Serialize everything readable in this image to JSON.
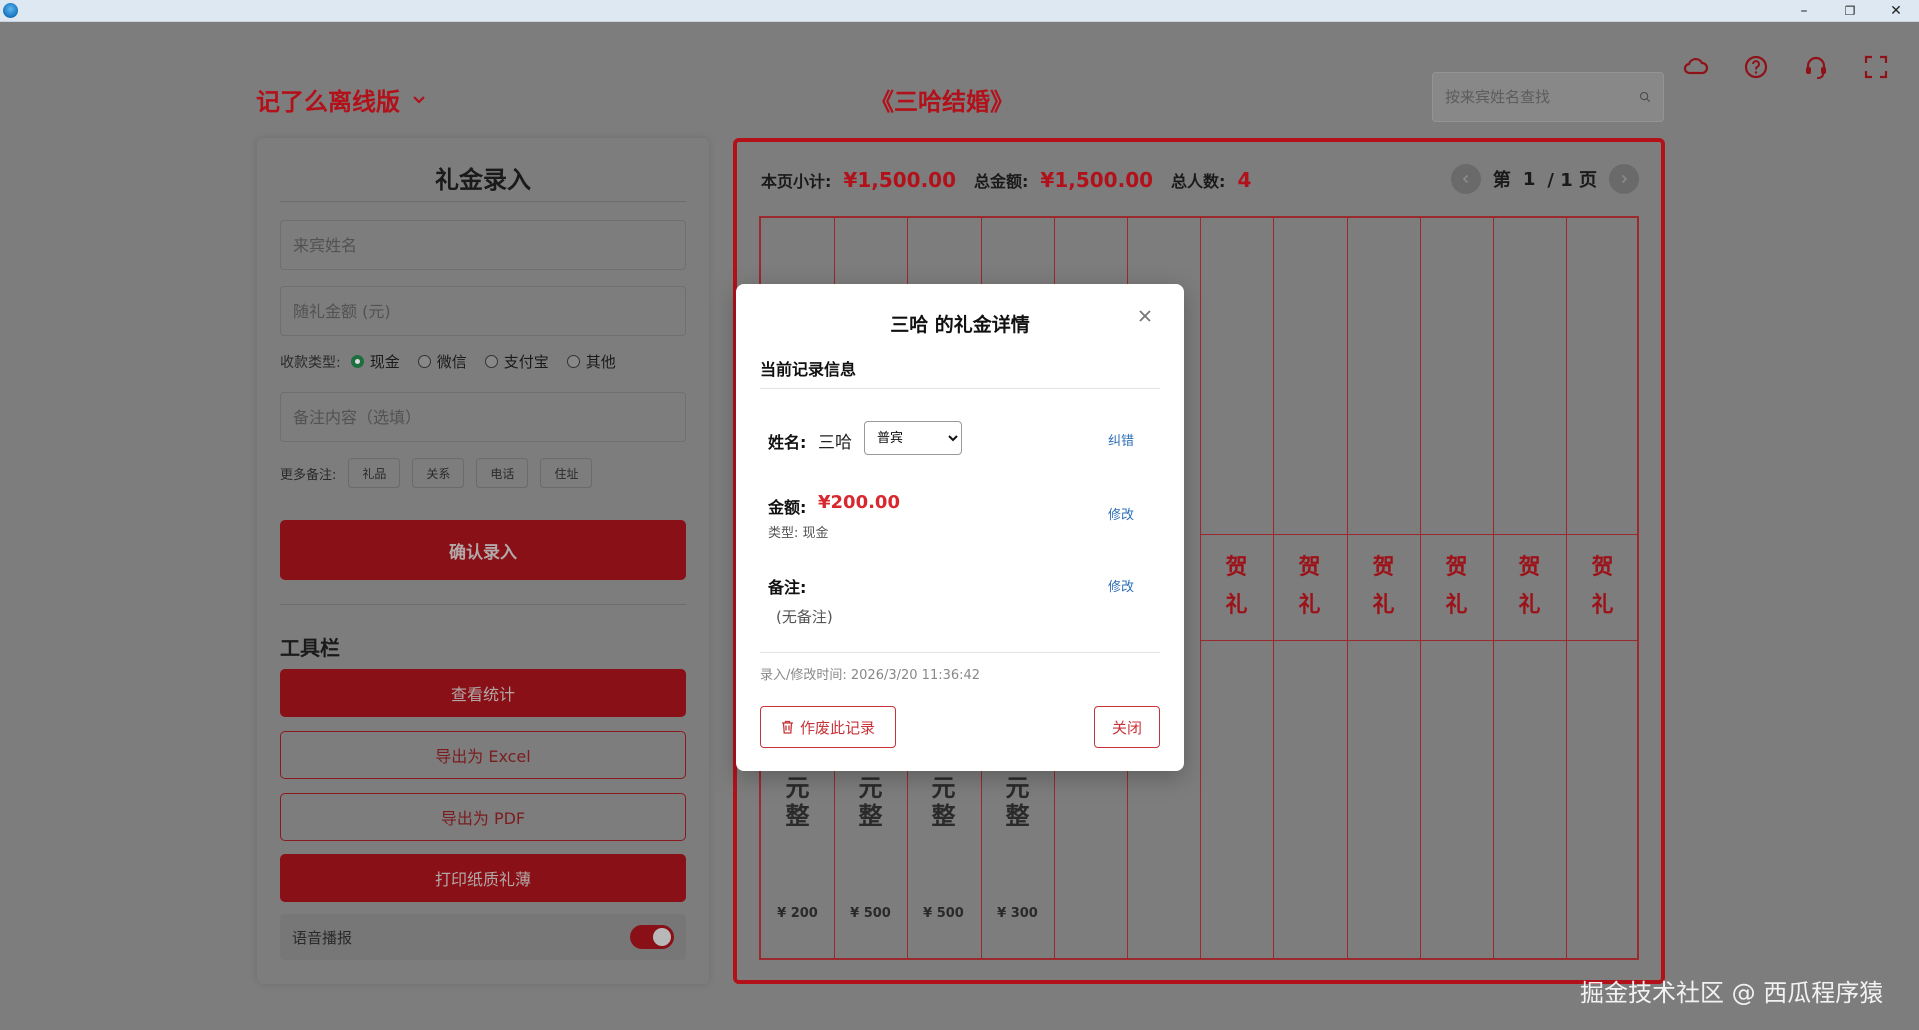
{
  "window": {
    "minimize": "–",
    "restore": "❐",
    "close": "✕"
  },
  "header": {
    "brand": "记了么离线版",
    "event_title": "《三哈结婚》",
    "search_placeholder": "按来宾姓名查找",
    "toolbar_icons": [
      "cloud-icon",
      "help-icon",
      "headset-icon",
      "fullscreen-icon"
    ]
  },
  "entry": {
    "title": "礼金录入",
    "name_placeholder": "来宾姓名",
    "amount_placeholder": "随礼金额 (元)",
    "pay_type_label": "收款类型:",
    "pay_types": [
      "现金",
      "微信",
      "支付宝",
      "其他"
    ],
    "pay_selected": "现金",
    "note_placeholder": "备注内容（选填）",
    "more_label": "更多备注:",
    "more_chips": [
      "礼品",
      "关系",
      "电话",
      "住址"
    ],
    "confirm": "确认录入",
    "tools_title": "工具栏",
    "tools": [
      "查看统计",
      "导出为 Excel",
      "导出为 PDF",
      "打印纸质礼薄"
    ],
    "voice_label": "语音播报",
    "voice_on": true
  },
  "ledger": {
    "subtotal_label": "本页小计:",
    "subtotal": "¥1,500.00",
    "total_label": "总金额:",
    "total": "¥1,500.00",
    "count_label": "总人数:",
    "count": "4",
    "page_prefix": "第",
    "page_current": "1",
    "page_suffix": "/ 1 页",
    "he_li": [
      "贺",
      "礼"
    ],
    "amount_words_tail": [
      "元",
      "整"
    ],
    "amounts": [
      "¥ 200",
      "¥ 500",
      "¥ 500",
      "¥ 300"
    ]
  },
  "modal": {
    "title": "三哈 的礼金详情",
    "section": "当前记录信息",
    "name_label": "姓名:",
    "name": "三哈",
    "guest_type": "普宾",
    "correct_link": "纠错",
    "amount_label": "金额:",
    "amount": "¥200.00",
    "type_text": "类型: 现金",
    "edit_link": "修改",
    "note_label": "备注:",
    "note": "(无备注)",
    "time": "录入/修改时间: 2026/3/20 11:36:42",
    "void_button": "作废此记录",
    "close_button": "关闭"
  },
  "watermark": "掘金技术社区 @ 西瓜程序猿"
}
